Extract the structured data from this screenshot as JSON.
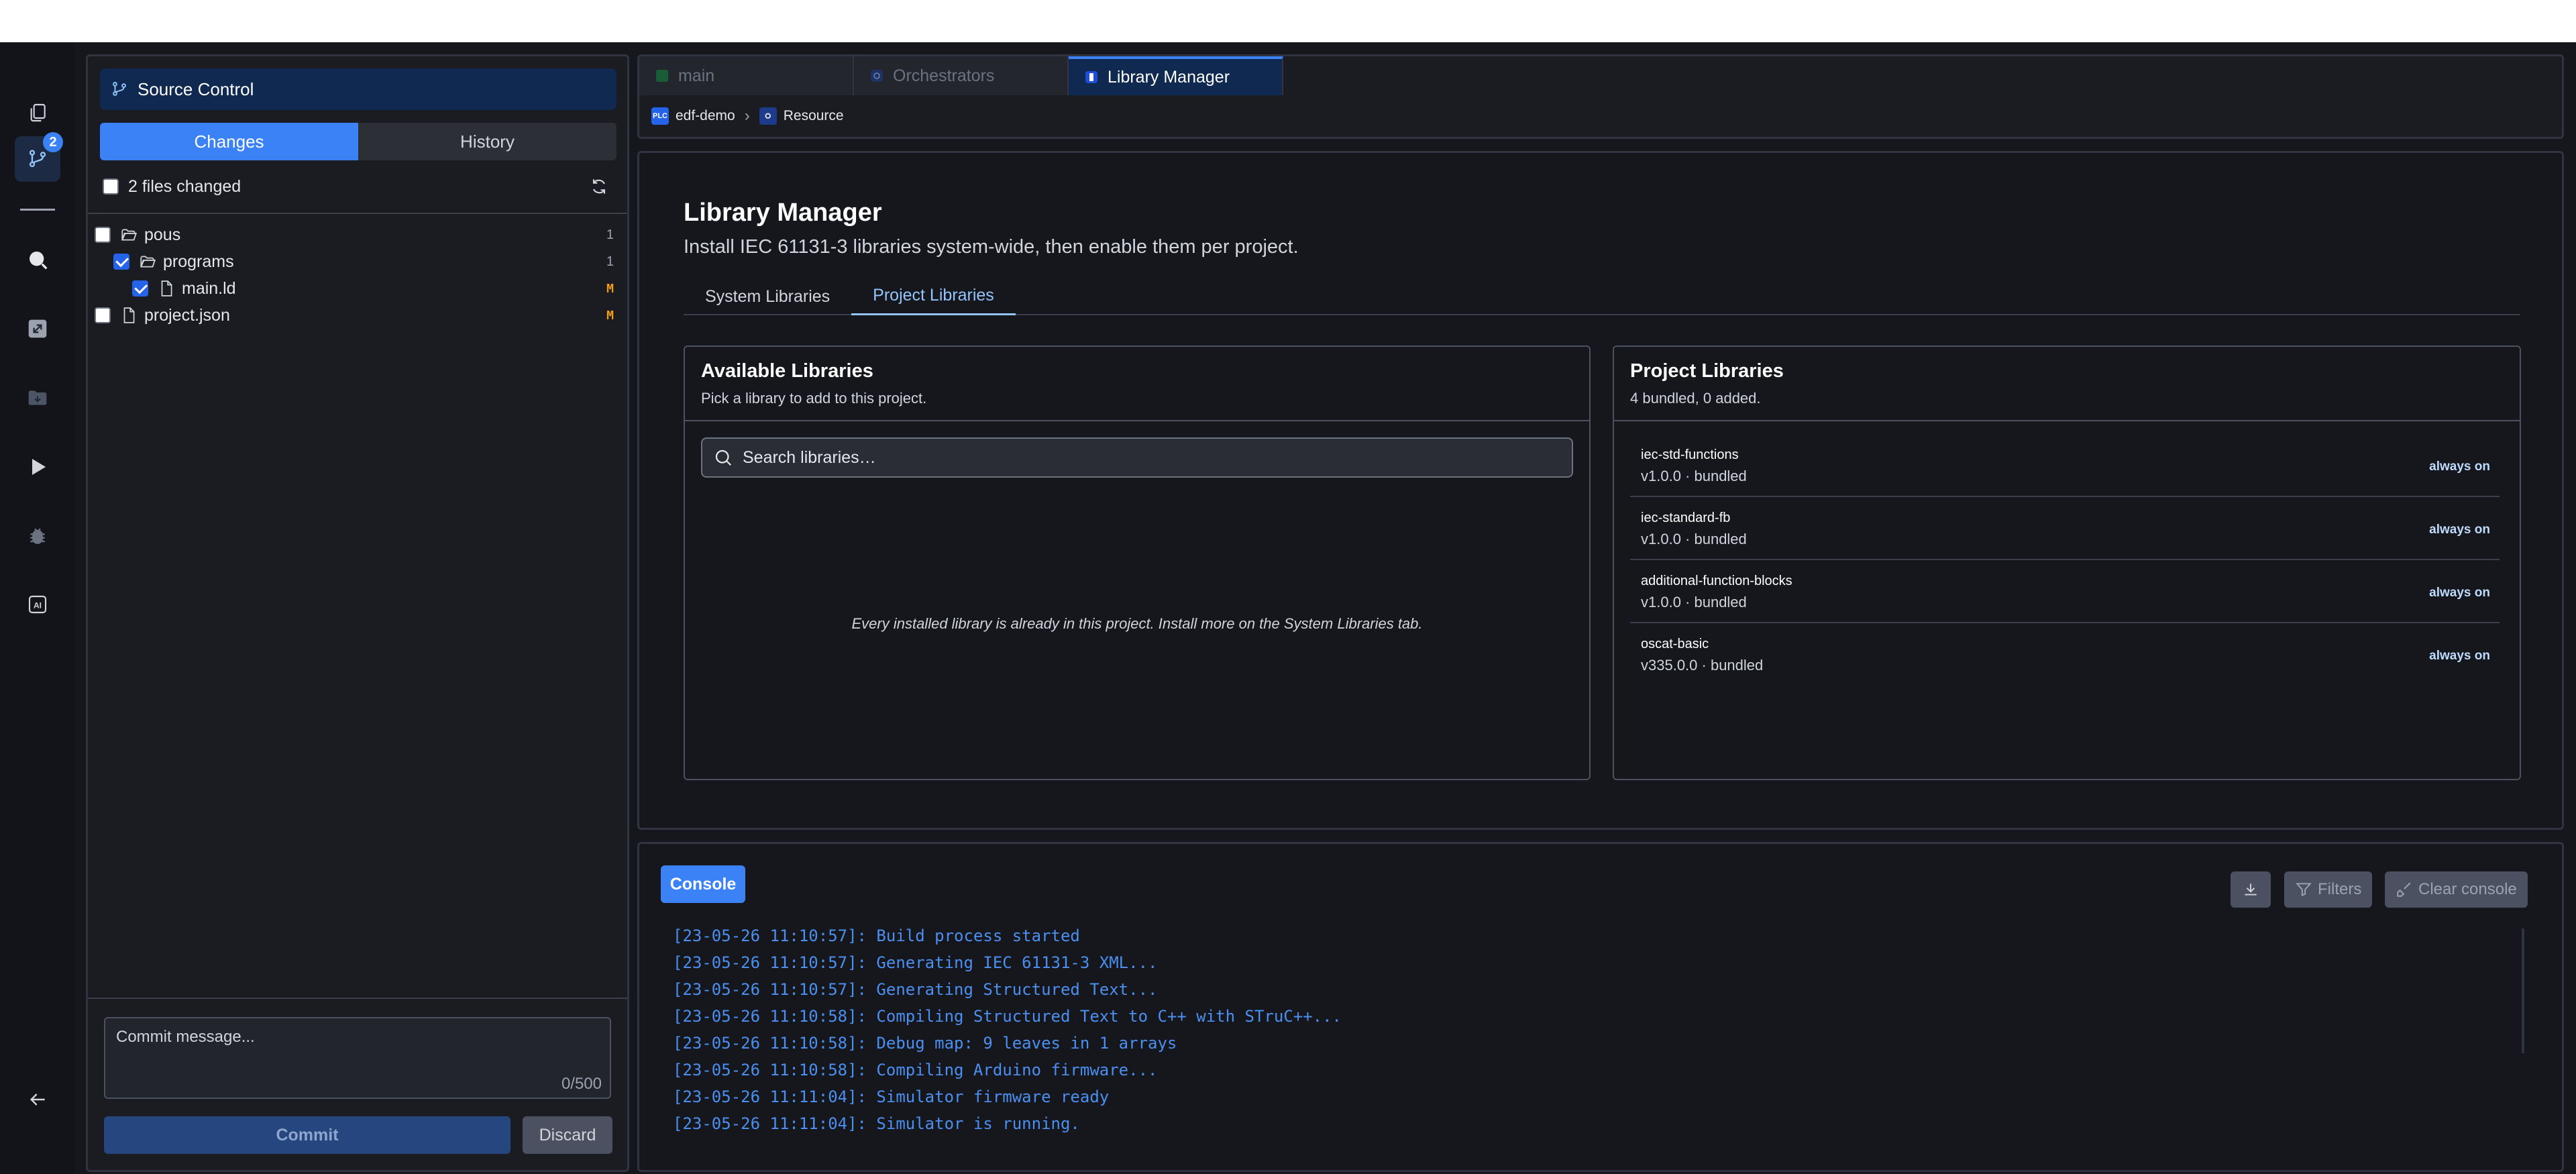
{
  "activity_bar": {
    "source_control_badge": "2"
  },
  "source_control": {
    "title": "Source Control",
    "tabs": [
      {
        "label": "Changes",
        "active": true
      },
      {
        "label": "History",
        "active": false
      }
    ],
    "files_changed": "2 files changed",
    "tree": [
      {
        "label": "pous",
        "type": "folder",
        "count": "1",
        "checked": false
      },
      {
        "label": "programs",
        "type": "folder",
        "count": "1",
        "checked": true
      },
      {
        "label": "main.ld",
        "type": "file",
        "status": "M",
        "checked": true
      },
      {
        "label": "project.json",
        "type": "file",
        "status": "M",
        "checked": false
      }
    ],
    "commit_placeholder": "Commit message...",
    "commit_count": "0/500",
    "commit_label": "Commit",
    "discard_label": "Discard"
  },
  "editor_tabs": [
    {
      "label": "main",
      "active": false
    },
    {
      "label": "Orchestrators",
      "active": false
    },
    {
      "label": "Library Manager",
      "active": true
    }
  ],
  "breadcrumb": {
    "project_badge": "PLC",
    "project": "edf-demo",
    "resource": "Resource"
  },
  "library_manager": {
    "title": "Library Manager",
    "subtitle": "Install IEC 61131-3 libraries system-wide, then enable them per project.",
    "tabs": [
      {
        "label": "System Libraries",
        "active": false
      },
      {
        "label": "Project Libraries",
        "active": true
      }
    ],
    "available": {
      "title": "Available Libraries",
      "subtitle": "Pick a library to add to this project.",
      "search_placeholder": "Search libraries…",
      "empty_message": "Every installed library is already in this project. Install more on the System Libraries tab."
    },
    "project": {
      "title": "Project Libraries",
      "subtitle": "4 bundled, 0 added.",
      "libraries": [
        {
          "name": "iec-std-functions",
          "version": "v1.0.0 · bundled",
          "status": "always on"
        },
        {
          "name": "iec-standard-fb",
          "version": "v1.0.0 · bundled",
          "status": "always on"
        },
        {
          "name": "additional-function-blocks",
          "version": "v1.0.0 · bundled",
          "status": "always on"
        },
        {
          "name": "oscat-basic",
          "version": "v335.0.0 · bundled",
          "status": "always on"
        }
      ]
    }
  },
  "console": {
    "tab_label": "Console",
    "filters_label": "Filters",
    "clear_label": "Clear console",
    "lines": [
      "[23-05-26 11:10:57]: Build process started",
      "[23-05-26 11:10:57]: Generating IEC 61131-3 XML...",
      "[23-05-26 11:10:57]: Generating Structured Text...",
      "[23-05-26 11:10:58]: Compiling Structured Text to C++ with STruC++...",
      "[23-05-26 11:10:58]: Debug map: 9 leaves in 1 arrays",
      "[23-05-26 11:10:58]: Compiling Arduino firmware...",
      "[23-05-26 11:11:04]: Simulator firmware ready",
      "[23-05-26 11:11:04]: Simulator is running."
    ]
  },
  "colors": {
    "accent": "#3b82f6",
    "background": "#15171c",
    "log_text": "#4b8ff0",
    "modified": "#f59e0b"
  }
}
